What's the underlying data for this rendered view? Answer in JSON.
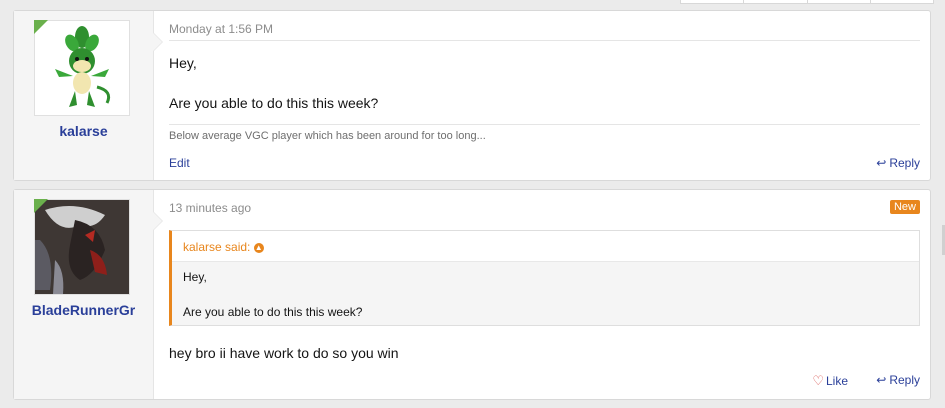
{
  "posts": [
    {
      "username": "kalarse",
      "date": "Monday at 1:56 PM",
      "message_lines": [
        "Hey,",
        "Are you able to do this this week?"
      ],
      "signature": "Below average VGC player which has been around for too long...",
      "actions": {
        "edit": "Edit",
        "reply": "Reply"
      },
      "avatar_icon": "pokemon-sprite-avatar"
    },
    {
      "username": "BladeRunnerGr",
      "date": "13 minutes ago",
      "badge": "New",
      "quote": {
        "author": "kalarse said:",
        "lines": [
          "Hey,",
          "Are you able to do this this week?"
        ]
      },
      "message": "hey bro ii have work to do so you win",
      "actions": {
        "like": "Like",
        "reply": "Reply"
      },
      "avatar_icon": "dark-character-avatar"
    }
  ],
  "colors": {
    "accent": "#2a3f99",
    "quote": "#e8861d",
    "online": "#6ab04c",
    "background": "#ebebeb"
  }
}
